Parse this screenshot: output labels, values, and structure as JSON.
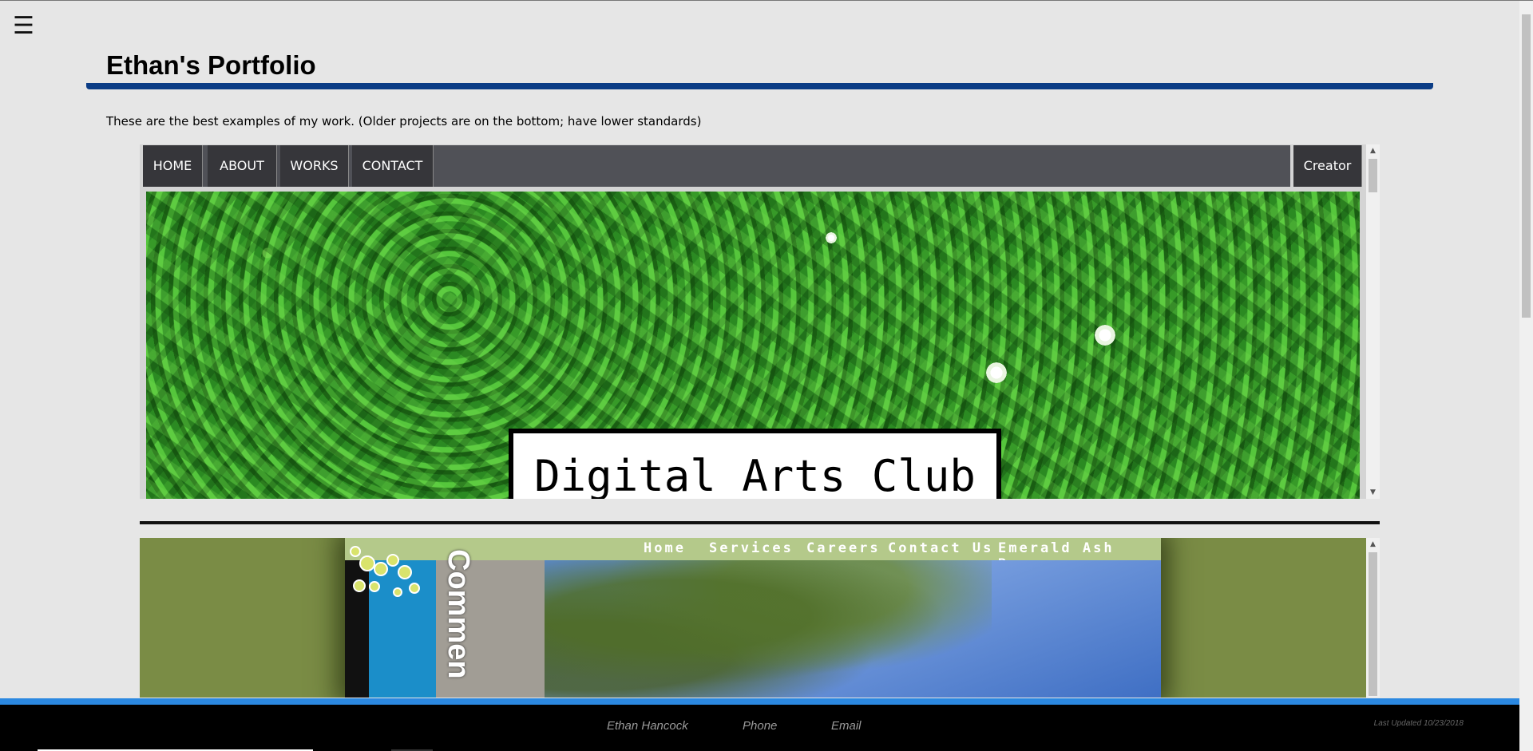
{
  "menu_icon": "☰",
  "header": {
    "title": "Ethan's Portfolio",
    "intro": "These are the best examples of my work. (Older projects are on the bottom; have lower standards)"
  },
  "project1": {
    "nav": [
      "HOME",
      "ABOUT",
      "WORKS",
      "CONTACT"
    ],
    "creator": "Creator",
    "hero_title": "Digital Arts Club"
  },
  "project2": {
    "nav": [
      "Home",
      "Services",
      "Careers",
      "Contact Us",
      "Emerald Ash Bore"
    ],
    "vertical_text": "Commen"
  },
  "footer": {
    "name": "Ethan Hancock",
    "phone": "Phone",
    "email": "Email",
    "updated": "Last Updated 10/23/2018"
  },
  "colors": {
    "accent_rule": "#0c3d86",
    "footer_bar": "#2b88e0",
    "project2_bg": "#7a8c45"
  }
}
